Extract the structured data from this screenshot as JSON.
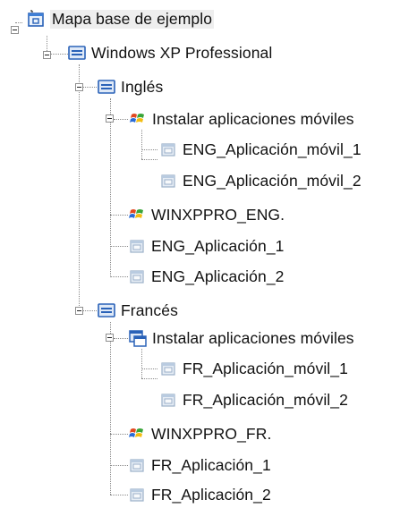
{
  "tree": {
    "root": {
      "label": "Mapa base de ejemplo",
      "icon": "base-map-icon"
    },
    "os": {
      "label": "Windows XP Professional",
      "icon": "os-image-icon"
    },
    "lang_en": {
      "label": "Inglés",
      "icon": "language-icon",
      "install_group": {
        "label": "Instalar aplicaciones móviles",
        "icon": "windows-flag-icon"
      },
      "mobile_apps": [
        "ENG_Aplicación_móvil_1",
        "ENG_Aplicación_móvil_2"
      ],
      "os_package": {
        "label": "WINXPPRO_ENG.",
        "icon": "windows-flag-icon"
      },
      "apps": [
        "ENG_Aplicación_1",
        "ENG_Aplicación_2"
      ]
    },
    "lang_fr": {
      "label": "Francés",
      "icon": "language-icon",
      "install_group": {
        "label": "Instalar aplicaciones móviles",
        "icon": "window-group-icon"
      },
      "mobile_apps": [
        "FR_Aplicación_móvil_1",
        "FR_Aplicación_móvil_2"
      ],
      "os_package": {
        "label": "WINXPPRO_FR.",
        "icon": "windows-flag-icon"
      },
      "apps": [
        "FR_Aplicación_1",
        "FR_Aplicación_2"
      ]
    },
    "app_icon": "application-package-icon"
  }
}
